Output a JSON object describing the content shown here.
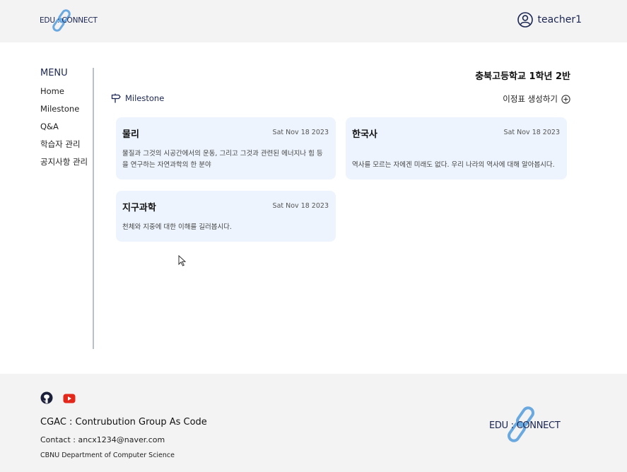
{
  "brand": {
    "logo_text": "EDU : CONNECT",
    "accent": "#6aa8e0",
    "navy": "#1a2550"
  },
  "header": {
    "username": "teacher1"
  },
  "sidebar": {
    "title": "MENU",
    "items": [
      {
        "label": "Home"
      },
      {
        "label": "Milestone"
      },
      {
        "label": "Q&A"
      },
      {
        "label": "학습자 관리"
      },
      {
        "label": "공지사항 관리"
      }
    ]
  },
  "main": {
    "class_title": "충북고등학교 1학년 2반",
    "section_label": "Milestone",
    "create_label": "이정표 생성하기",
    "cards": [
      {
        "title": "물리",
        "date": "Sat Nov 18 2023",
        "desc": "물질과 그것의 시공간에서의 운동, 그리고 그것과 관련된 에너지나 힘 등을 연구하는 자연과학의 한 분야"
      },
      {
        "title": "한국사",
        "date": "Sat Nov 18 2023",
        "desc": "역사를 모르는 자에겐 미래도 없다. 우리 나라의 역사에 대해 알아봅시다."
      },
      {
        "title": "지구과학",
        "date": "Sat Nov 18 2023",
        "desc": "천체와 지중에 대한 이해를 길러봅시다."
      }
    ],
    "card_bg": "#edf4fd"
  },
  "footer": {
    "icons": [
      "github-icon",
      "youtube-icon"
    ],
    "org": "CGAC : Contrubution Group As Code",
    "contact": "Contact : ancx1234@naver.com",
    "dept": "CBNU Department of Computer Science",
    "logo_text": "EDU : CONNECT"
  }
}
